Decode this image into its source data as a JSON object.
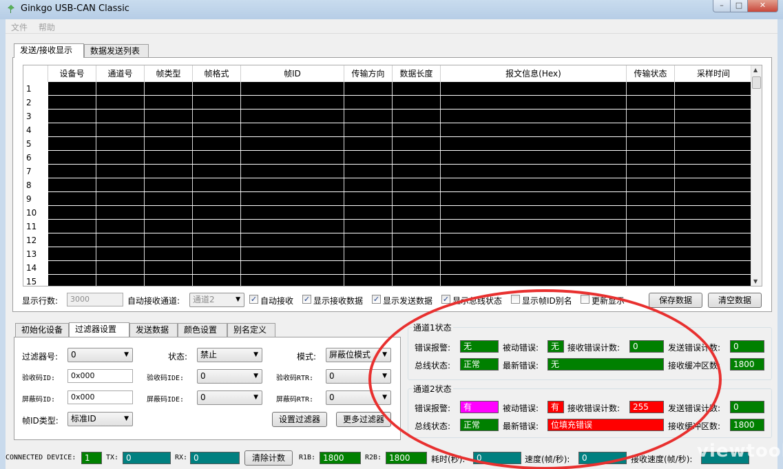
{
  "window": {
    "title": "Ginkgo USB-CAN Classic",
    "min": "–",
    "max": "□",
    "close": "✕"
  },
  "menu": [
    "文件",
    "帮助"
  ],
  "top_tabs": [
    "发送/接收显示",
    "数据发送列表"
  ],
  "grid": {
    "columns": [
      "设备号",
      "通道号",
      "帧类型",
      "帧格式",
      "帧ID",
      "传输方向",
      "数据长度",
      "报文信息(Hex)",
      "传输状态",
      "采样时间"
    ],
    "row_numbers": [
      "1",
      "2",
      "3",
      "4",
      "5",
      "6",
      "7",
      "8",
      "9",
      "10",
      "11",
      "12",
      "13",
      "14",
      "15"
    ]
  },
  "options": {
    "rows_label": "显示行数:",
    "rows_value": "3000",
    "auto_channel_label": "自动接收通道:",
    "auto_channel_value": "通道2",
    "checks": [
      {
        "label": "自动接收",
        "checked": true
      },
      {
        "label": "显示接收数据",
        "checked": true
      },
      {
        "label": "显示发送数据",
        "checked": true
      },
      {
        "label": "显示总线状态",
        "checked": true
      },
      {
        "label": "显示帧ID别名",
        "checked": false
      },
      {
        "label": "更新显示",
        "checked": false
      }
    ],
    "save_btn": "保存数据",
    "clear_btn": "清空数据"
  },
  "bottom_tabs": [
    "初始化设备",
    "过滤器设置",
    "发送数据",
    "颜色设置",
    "别名定义"
  ],
  "filter": {
    "filter_no_label": "过滤器号:",
    "filter_no_value": "0",
    "state_label": "状态:",
    "state_value": "禁止",
    "mode_label": "模式:",
    "mode_value": "屏蔽位模式",
    "acc_id_label": "验收码ID:",
    "acc_id_value": "0x000",
    "acc_ide_label": "验收码IDE:",
    "acc_ide_value": "0",
    "acc_rtr_label": "验收码RTR:",
    "acc_rtr_value": "0",
    "mask_id_label": "屏蔽码ID:",
    "mask_id_value": "0x000",
    "mask_ide_label": "屏蔽码IDE:",
    "mask_ide_value": "0",
    "mask_rtr_label": "屏蔽码RTR:",
    "mask_rtr_value": "0",
    "frame_type_label": "帧ID类型:",
    "frame_type_value": "标准ID",
    "set_btn": "设置过滤器",
    "more_btn": "更多过滤器"
  },
  "ch1": {
    "title": "通道1状态",
    "err_alarm_label": "错误报警:",
    "err_alarm": "无",
    "passive_label": "被动错误:",
    "passive": "无",
    "rx_err_label": "接收错误计数:",
    "rx_err": "0",
    "tx_err_label": "发送错误计数:",
    "tx_err": "0",
    "bus_label": "总线状态:",
    "bus": "正常",
    "latest_label": "最新错误:",
    "latest": "无",
    "rxbuf_label": "接收缓冲区数:",
    "rxbuf": "1800"
  },
  "ch2": {
    "title": "通道2状态",
    "err_alarm_label": "错误报警:",
    "err_alarm": "有",
    "passive_label": "被动错误:",
    "passive": "有",
    "rx_err_label": "接收错误计数:",
    "rx_err": "255",
    "tx_err_label": "发送错误计数:",
    "tx_err": "0",
    "bus_label": "总线状态:",
    "bus": "正常",
    "latest_label": "最新错误:",
    "latest": "位填充错误",
    "rxbuf_label": "接收缓冲区数:",
    "rxbuf": "1800"
  },
  "statusbar": {
    "device_label": "CONNECTED DEVICE:",
    "device": "1",
    "tx_label": "TX:",
    "tx": "0",
    "rx_label": "RX:",
    "rx": "0",
    "clear_btn": "清除计数",
    "r1b_label": "R1B:",
    "r1b": "1800",
    "r2b_label": "R2B:",
    "r2b": "1800",
    "elapsed_label": "耗时(秒):",
    "elapsed": "0",
    "speed_label": "速度(帧/秒):",
    "speed": "0",
    "rx_speed_label": "接收速度(帧/秒):",
    "rx_speed": ""
  },
  "watermark": "viewtool",
  "colors": {
    "ok": "#008000",
    "error": "#ff0000",
    "alarm": "#ff00ff",
    "counter": "#008080",
    "annotation": "#e8302f"
  }
}
